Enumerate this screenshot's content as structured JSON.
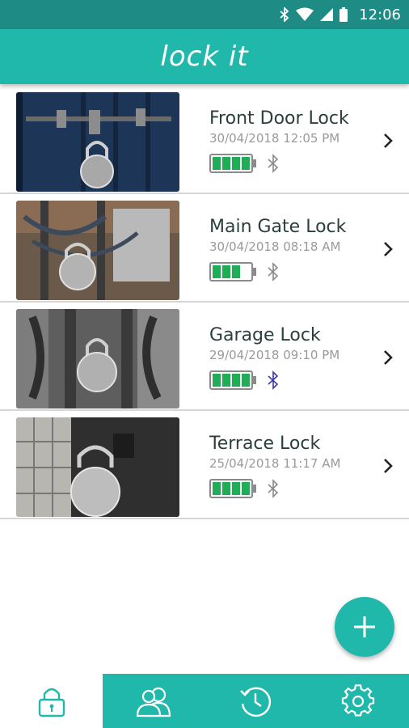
{
  "status_bar": {
    "time": "12:06",
    "icons": [
      "bluetooth-icon",
      "wifi-icon",
      "signal-icon",
      "battery-icon"
    ]
  },
  "app": {
    "logo_text": "lock it"
  },
  "locks": [
    {
      "name": "Front Door Lock",
      "datetime": "30/04/2018 12:05 PM",
      "battery_level": 1.0,
      "bluetooth_active": false
    },
    {
      "name": "Main Gate Lock",
      "datetime": "30/04/2018 08:18 AM",
      "battery_level": 0.75,
      "bluetooth_active": false
    },
    {
      "name": "Garage Lock",
      "datetime": "29/04/2018 09:10 PM",
      "battery_level": 1.0,
      "bluetooth_active": true
    },
    {
      "name": "Terrace Lock",
      "datetime": "25/04/2018 11:17 AM",
      "battery_level": 1.0,
      "bluetooth_active": false
    }
  ],
  "fab": {
    "icon": "plus-icon"
  },
  "bottom_nav": [
    {
      "icon": "padlock-icon",
      "active": true
    },
    {
      "icon": "users-icon",
      "active": false
    },
    {
      "icon": "history-icon",
      "active": false
    },
    {
      "icon": "gear-icon",
      "active": false
    }
  ],
  "colors": {
    "primary": "#21b8ac",
    "status_bar": "#1e8c85",
    "battery_fill": "#1fae55",
    "bluetooth_active": "#3a3aa8",
    "bluetooth_inactive": "#8a8a8a"
  }
}
